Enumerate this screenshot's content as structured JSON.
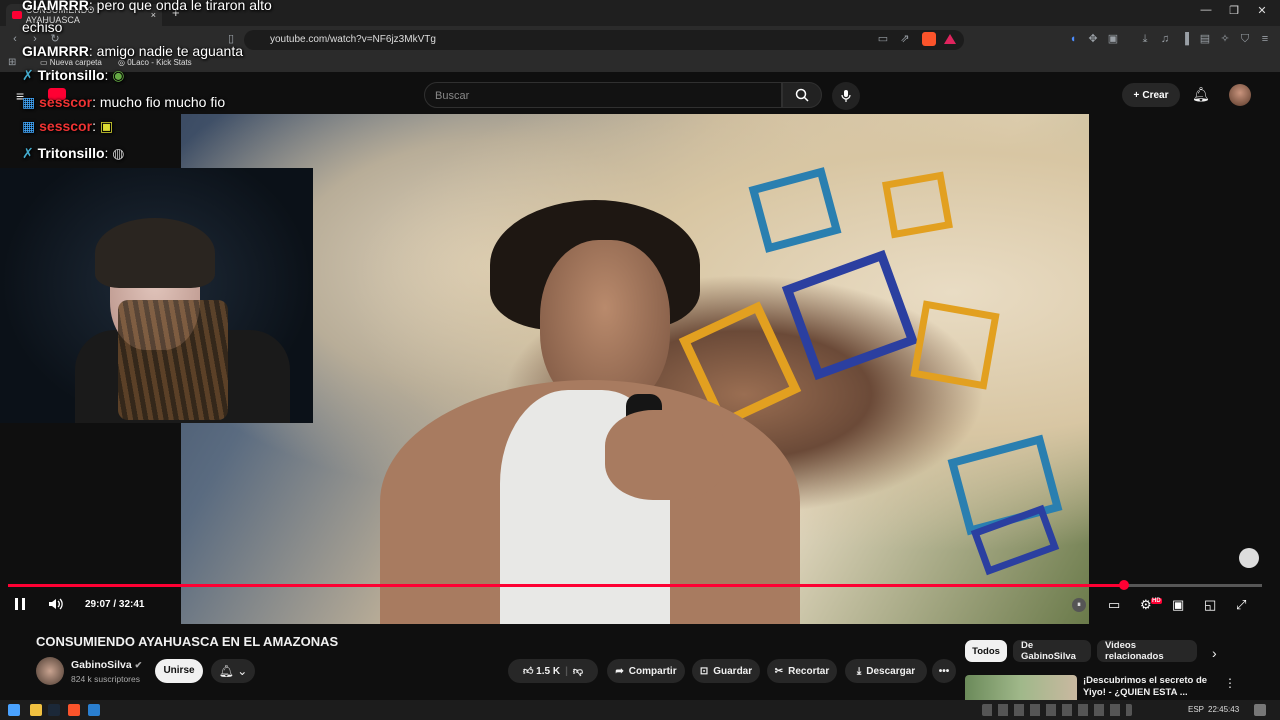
{
  "browser": {
    "tab_title": "CONSUMIENDO AYAHUASCA",
    "tab_close": "×",
    "new_tab": "+",
    "url": "youtube.com/watch?v=NF6jz3MkVTg",
    "bookmarks": [
      "Nueva carpeta",
      "0Laco - Kick Stats"
    ],
    "window_controls": {
      "minimize": "—",
      "restore": "❐",
      "close": "✕"
    }
  },
  "youtube_header": {
    "search_placeholder": "Buscar",
    "create_label": "Crear",
    "icons": [
      "menu-icon",
      "search-icon",
      "mic-icon",
      "bell-icon"
    ]
  },
  "chat": [
    {
      "user": "GIAMRRR",
      "message": "pero que onda le tiraron alto"
    },
    {
      "user": "",
      "message": "echiso"
    },
    {
      "user": "GIAMRRR",
      "message": "amigo nadie te aguanta"
    },
    {
      "user": "Tritonsillo",
      "message": ""
    },
    {
      "user": "sesscor",
      "message": "mucho fio mucho fio"
    },
    {
      "user": "sesscor",
      "message": ""
    },
    {
      "user": "Tritonsillo",
      "message": ""
    }
  ],
  "player": {
    "time_current": "29:07",
    "time_total": "32:41",
    "time_display": "29:07 / 32:41",
    "progress_fraction": 0.89,
    "quality_badge": "HD"
  },
  "video_info": {
    "title": "CONSUMIENDO AYAHUASCA EN EL AMAZONAS",
    "channel": "GabinoSilva",
    "subscribers": "824 k suscriptores",
    "join_label": "Unirse",
    "likes": "1.5 K",
    "share_label": "Compartir",
    "save_label": "Guardar",
    "clip_label": "Recortar",
    "download_label": "Descargar"
  },
  "related": {
    "chips": [
      "Todos",
      "De GabinoSilva",
      "Videos relacionados"
    ],
    "first_video_title": "¡Descubrimos el secreto de Yiyo! - ¿QUIEN ESTA ..."
  },
  "taskbar": {
    "language": "ESP",
    "clock": "22:45:43"
  },
  "colors": {
    "accent": "#ff0033",
    "background": "#0f0f0f",
    "pill": "#272727"
  }
}
